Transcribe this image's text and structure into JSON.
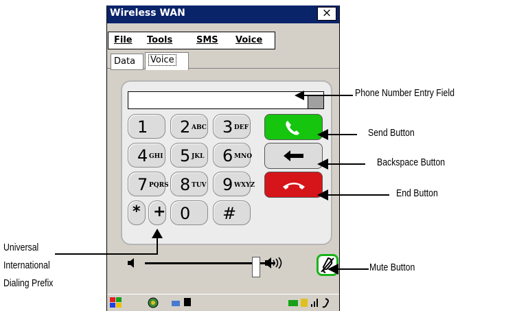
{
  "window": {
    "title": "Wireless WAN",
    "close_symbol": "×"
  },
  "menu": [
    "File",
    "Tools",
    "SMS",
    "Voice"
  ],
  "tabs": [
    {
      "label": "Data",
      "active": false
    },
    {
      "label": "Voice",
      "active": true
    }
  ],
  "phone_field": {
    "value": ""
  },
  "keys": [
    {
      "digit": "1",
      "letters": ""
    },
    {
      "digit": "2",
      "letters": "ABC"
    },
    {
      "digit": "3",
      "letters": "DEF"
    },
    {
      "digit": "4",
      "letters": "GHI"
    },
    {
      "digit": "5",
      "letters": "JKL"
    },
    {
      "digit": "6",
      "letters": "MNO"
    },
    {
      "digit": "7",
      "letters": "PQRS"
    },
    {
      "digit": "8",
      "letters": "TUV"
    },
    {
      "digit": "9",
      "letters": "WXYZ"
    },
    {
      "digit": "*",
      "letters": ""
    },
    {
      "digit": "+",
      "letters": ""
    },
    {
      "digit": "0",
      "letters": ""
    },
    {
      "digit": "#",
      "letters": ""
    }
  ],
  "actions": {
    "send": {
      "icon": "phone-handset-icon",
      "color": "#15c50e"
    },
    "backspace": {
      "icon": "left-arrow-icon",
      "color": "#dcdcdc"
    },
    "end": {
      "icon": "hang-up-icon",
      "color": "#d6151a"
    }
  },
  "volume": {
    "level": 0.85
  },
  "mute": {
    "icon": "microphone-muted-icon",
    "color": "#18b418"
  },
  "annotations": {
    "phone_field": "Phone Number Entry Field",
    "send": "Send Button",
    "backspace": "Backspace Button",
    "end": "End Button",
    "mute": "Mute Button",
    "prefix_line1": "Universal",
    "prefix_line2": "International",
    "prefix_line3": "Dialing Prefix"
  }
}
